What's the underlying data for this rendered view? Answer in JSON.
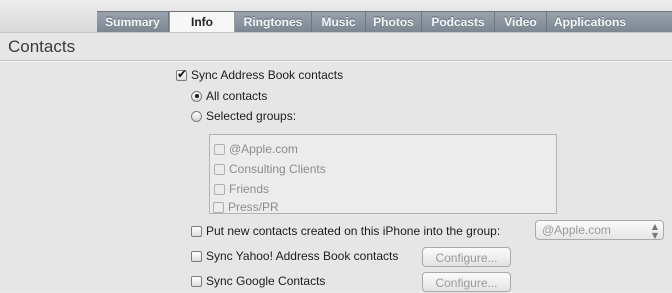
{
  "tabs": [
    "Summary",
    "Info",
    "Ringtones",
    "Music",
    "Photos",
    "Podcasts",
    "Video",
    "Applications"
  ],
  "active_tab": "Info",
  "section": {
    "title": "Contacts"
  },
  "sync_address_book": {
    "label": "Sync Address Book contacts",
    "checked": true
  },
  "all_contacts": {
    "label": "All contacts",
    "selected": true
  },
  "selected_groups": {
    "label": "Selected groups:",
    "selected": false,
    "groups": [
      "@Apple.com",
      "Consulting Clients",
      "Friends",
      "Press/PR"
    ]
  },
  "put_new_contacts": {
    "label": "Put new contacts created on this iPhone into the group:",
    "checked": false,
    "group_value": "@Apple.com"
  },
  "sync_yahoo": {
    "label": "Sync Yahoo! Address Book contacts",
    "checked": false,
    "button": "Configure..."
  },
  "sync_google": {
    "label": "Sync Google Contacts",
    "checked": false,
    "button": "Configure..."
  }
}
